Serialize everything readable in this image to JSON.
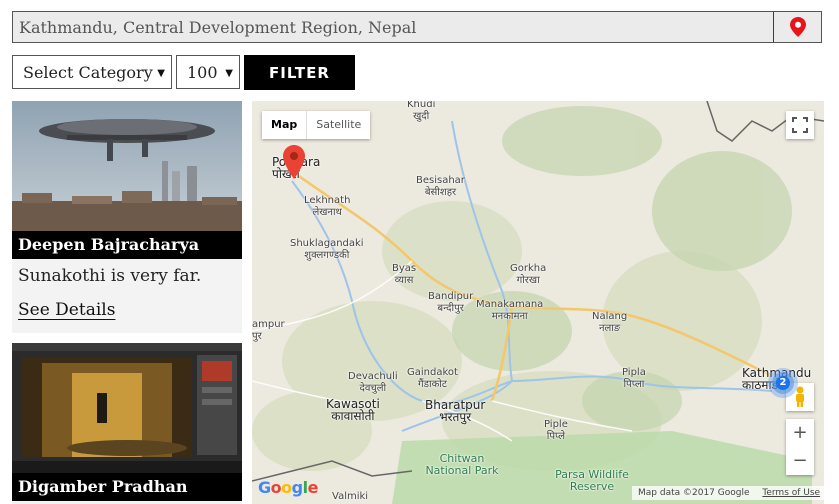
{
  "search": {
    "value": "Kathmandu, Central Development Region, Nepal",
    "pin_icon": "location-pin-icon",
    "pin_color": "#e8141b"
  },
  "filters": {
    "category": "Select Category",
    "count": "100",
    "filter_label": "FILTER"
  },
  "cards": [
    {
      "name": "Deepen Bajracharya",
      "description": "Sunakothi is very far.",
      "details_label": "See Details"
    },
    {
      "name": "Digamber Pradhan"
    }
  ],
  "map": {
    "type_map": "Map",
    "type_satellite": "Satellite",
    "cluster_count": "2",
    "cities": {
      "pokhara": "Pokhara",
      "pokhara_np": "पोखरा",
      "khudi": "Khudi",
      "khudi_np": "खुदी",
      "besisahar": "Besisahar",
      "besisahar_np": "बेसीशहर",
      "lekhnath": "Lekhnath",
      "lekhnath_np": "लेखनाथ",
      "shuklagandaki": "Shuklagandaki",
      "shuklagandaki_np": "शुक्लगण्डकी",
      "byas": "Byas",
      "byas_np": "व्यास",
      "gorkha": "Gorkha",
      "gorkha_np": "गोरखा",
      "bandipur": "Bandipur",
      "bandipur_np": "बन्दीपुर",
      "manakamana": "Manakamana",
      "manakamana_np": "मनकामना",
      "nalang": "Nalang",
      "nalang_np": "नलाङ",
      "rampur": "ampur",
      "rampur_np": "पुर",
      "devachuli": "Devachuli",
      "devachuli_np": "देवचुली",
      "gaindakot": "Gaindakot",
      "gaindakot_np": "गैंडाकोट",
      "kawasoti": "Kawasoti",
      "kawasoti_np": "कावासोती",
      "bharatpur": "Bharatpur",
      "bharatpur_np": "भरतपुर",
      "pipla": "Pipla",
      "pipla_np": "पिप्ला",
      "piple": "Piple",
      "piple_np": "पिप्ले",
      "kathmandu": "Kathmandu",
      "kathmandu_np": "काठमाडौं",
      "chitwan": "Chitwan National Park",
      "parsa": "Parsa Wildlife Reserve",
      "valmiki": "Valmiki"
    },
    "google": "Google",
    "attribution": "Map data ©2017 Google",
    "terms": "Terms of Use"
  }
}
